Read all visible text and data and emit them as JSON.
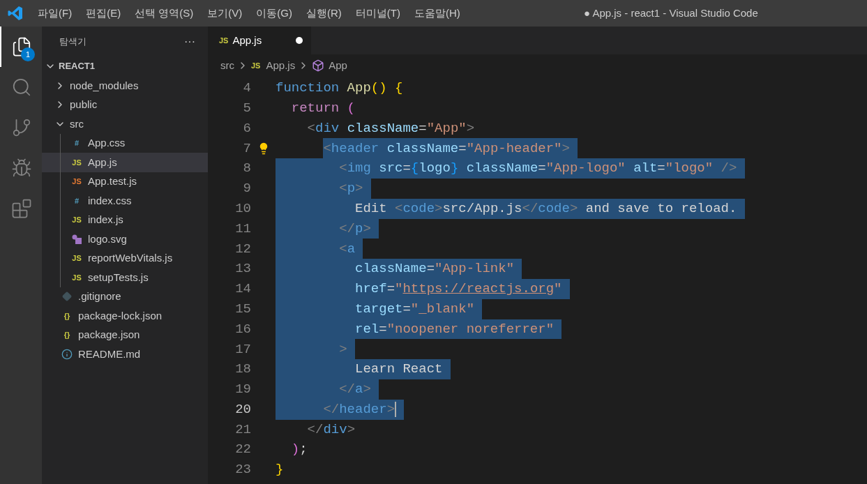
{
  "window": {
    "title": "● App.js - react1 - Visual Studio Code"
  },
  "menu": [
    "파일(F)",
    "편집(E)",
    "선택 영역(S)",
    "보기(V)",
    "이동(G)",
    "실행(R)",
    "터미널(T)",
    "도움말(H)"
  ],
  "activity_bar": [
    {
      "kind": "explorer",
      "selected": true,
      "badge": "1"
    },
    {
      "kind": "search",
      "selected": false
    },
    {
      "kind": "source-control",
      "selected": false
    },
    {
      "kind": "run",
      "selected": false
    },
    {
      "kind": "extensions",
      "selected": false
    }
  ],
  "sidebar": {
    "title": "탐색기",
    "more": "···",
    "root": {
      "label": "REACT1",
      "expanded": true,
      "children": [
        {
          "label": "node_modules",
          "kind": "folder",
          "expanded": false,
          "selected": false
        },
        {
          "label": "public",
          "kind": "folder",
          "expanded": false,
          "selected": false
        },
        {
          "label": "src",
          "kind": "folder",
          "expanded": true,
          "selected": false,
          "children": [
            {
              "label": "App.css",
              "kind": "css",
              "glyph": "#",
              "selected": false
            },
            {
              "label": "App.js",
              "kind": "js",
              "glyph": "JS",
              "selected": true
            },
            {
              "label": "App.test.js",
              "kind": "test",
              "glyph": "JS",
              "selected": false
            },
            {
              "label": "index.css",
              "kind": "css",
              "glyph": "#",
              "selected": false
            },
            {
              "label": "index.js",
              "kind": "js",
              "glyph": "JS",
              "selected": false
            },
            {
              "label": "logo.svg",
              "kind": "svg",
              "selected": false
            },
            {
              "label": "reportWebVitals.js",
              "kind": "js",
              "glyph": "JS",
              "selected": false
            },
            {
              "label": "setupTests.js",
              "kind": "js",
              "glyph": "JS",
              "selected": false
            }
          ]
        },
        {
          "label": ".gitignore",
          "kind": "git",
          "selected": false
        },
        {
          "label": "package-lock.json",
          "kind": "json",
          "glyph": "{}",
          "selected": false
        },
        {
          "label": "package.json",
          "kind": "json",
          "glyph": "{}",
          "selected": false
        },
        {
          "label": "README.md",
          "kind": "info",
          "selected": false
        }
      ]
    }
  },
  "tabs": [
    {
      "label": "App.js",
      "glyph": "JS",
      "selected": true,
      "modified": true
    }
  ],
  "breadcrumb": [
    {
      "label": "src",
      "kind": "folder"
    },
    {
      "label": "App.js",
      "kind": "js",
      "glyph": "JS"
    },
    {
      "label": "App",
      "kind": "component"
    }
  ],
  "editor": {
    "lines": [
      {
        "number": "4",
        "selected": false,
        "current": false,
        "tokens": [
          {
            "kind": "kw",
            "text": "function"
          },
          {
            "kind": "fn",
            "text": " App"
          },
          {
            "kind": "br1",
            "text": "() {"
          }
        ]
      },
      {
        "number": "5",
        "selected": false,
        "current": false,
        "tokens": [
          {
            "kind": "ctl",
            "text": "  return"
          },
          {
            "kind": "br2",
            "text": " ("
          }
        ]
      },
      {
        "number": "6",
        "selected": false,
        "current": false,
        "tokens": [
          {
            "kind": "punct",
            "text": "    <"
          },
          {
            "kind": "tag",
            "text": "div"
          },
          {
            "kind": "attr",
            "text": " className"
          },
          {
            "kind": "txt",
            "text": "="
          },
          {
            "kind": "str",
            "text": "\"App\""
          },
          {
            "kind": "punct",
            "text": ">"
          }
        ]
      },
      {
        "number": "7",
        "selected": true,
        "current": false,
        "lightbulb": true,
        "tokens": [
          {
            "kind": "punct",
            "text": "      <"
          },
          {
            "kind": "tag",
            "text": "header"
          },
          {
            "kind": "attr",
            "text": " className"
          },
          {
            "kind": "txt",
            "text": "="
          },
          {
            "kind": "str",
            "text": "\"App-header\""
          },
          {
            "kind": "punct",
            "text": ">"
          }
        ]
      },
      {
        "number": "8",
        "selected": true,
        "current": false,
        "tokens": [
          {
            "kind": "punct",
            "text": "        <"
          },
          {
            "kind": "tag",
            "text": "img"
          },
          {
            "kind": "attr",
            "text": " src"
          },
          {
            "kind": "txt",
            "text": "="
          },
          {
            "kind": "br3",
            "text": "{"
          },
          {
            "kind": "var",
            "text": "logo"
          },
          {
            "kind": "br3",
            "text": "}"
          },
          {
            "kind": "attr",
            "text": " className"
          },
          {
            "kind": "txt",
            "text": "="
          },
          {
            "kind": "str",
            "text": "\"App-logo\""
          },
          {
            "kind": "attr",
            "text": " alt"
          },
          {
            "kind": "txt",
            "text": "="
          },
          {
            "kind": "str",
            "text": "\"logo\""
          },
          {
            "kind": "punct",
            "text": " />"
          }
        ]
      },
      {
        "number": "9",
        "selected": true,
        "current": false,
        "tokens": [
          {
            "kind": "punct",
            "text": "        <"
          },
          {
            "kind": "tag",
            "text": "p"
          },
          {
            "kind": "punct",
            "text": ">"
          }
        ]
      },
      {
        "number": "10",
        "selected": true,
        "current": false,
        "tokens": [
          {
            "kind": "txt",
            "text": "          Edit"
          },
          {
            "kind": "punct",
            "text": " <"
          },
          {
            "kind": "tag",
            "text": "code"
          },
          {
            "kind": "punct",
            "text": ">"
          },
          {
            "kind": "txt",
            "text": "src/App.js"
          },
          {
            "kind": "punct",
            "text": "</"
          },
          {
            "kind": "tag",
            "text": "code"
          },
          {
            "kind": "punct",
            "text": ">"
          },
          {
            "kind": "txt",
            "text": " and save to reload."
          }
        ]
      },
      {
        "number": "11",
        "selected": true,
        "current": false,
        "tokens": [
          {
            "kind": "punct",
            "text": "        </"
          },
          {
            "kind": "tag",
            "text": "p"
          },
          {
            "kind": "punct",
            "text": ">"
          }
        ]
      },
      {
        "number": "12",
        "selected": true,
        "current": false,
        "tokens": [
          {
            "kind": "punct",
            "text": "        <"
          },
          {
            "kind": "tag",
            "text": "a"
          }
        ]
      },
      {
        "number": "13",
        "selected": true,
        "current": false,
        "tokens": [
          {
            "kind": "attr",
            "text": "          className"
          },
          {
            "kind": "txt",
            "text": "="
          },
          {
            "kind": "str",
            "text": "\"App-link\""
          }
        ]
      },
      {
        "number": "14",
        "selected": true,
        "current": false,
        "tokens": [
          {
            "kind": "attr",
            "text": "          href"
          },
          {
            "kind": "txt",
            "text": "="
          },
          {
            "kind": "str",
            "text": "\""
          },
          {
            "kind": "url",
            "text": "https://reactjs.org"
          },
          {
            "kind": "str",
            "text": "\""
          }
        ]
      },
      {
        "number": "15",
        "selected": true,
        "current": false,
        "tokens": [
          {
            "kind": "attr",
            "text": "          target"
          },
          {
            "kind": "txt",
            "text": "="
          },
          {
            "kind": "str",
            "text": "\"_blank\""
          }
        ]
      },
      {
        "number": "16",
        "selected": true,
        "current": false,
        "tokens": [
          {
            "kind": "attr",
            "text": "          rel"
          },
          {
            "kind": "txt",
            "text": "="
          },
          {
            "kind": "str",
            "text": "\"noopener noreferrer\""
          }
        ]
      },
      {
        "number": "17",
        "selected": true,
        "current": false,
        "tokens": [
          {
            "kind": "punct",
            "text": "        >"
          }
        ]
      },
      {
        "number": "18",
        "selected": true,
        "current": false,
        "tokens": [
          {
            "kind": "txt",
            "text": "          Learn React"
          }
        ]
      },
      {
        "number": "19",
        "selected": true,
        "current": false,
        "tokens": [
          {
            "kind": "punct",
            "text": "        </"
          },
          {
            "kind": "tag",
            "text": "a"
          },
          {
            "kind": "punct",
            "text": ">"
          }
        ]
      },
      {
        "number": "20",
        "selected": true,
        "current": true,
        "tokens": [
          {
            "kind": "punct",
            "text": "      </"
          },
          {
            "kind": "tag",
            "text": "header"
          },
          {
            "kind": "punct",
            "text": ">"
          }
        ]
      },
      {
        "number": "21",
        "selected": false,
        "current": false,
        "tokens": [
          {
            "kind": "punct",
            "text": "    </"
          },
          {
            "kind": "tag",
            "text": "div"
          },
          {
            "kind": "punct",
            "text": ">"
          }
        ]
      },
      {
        "number": "22",
        "selected": false,
        "current": false,
        "tokens": [
          {
            "kind": "br2",
            "text": "  )"
          },
          {
            "kind": "txt",
            "text": ";"
          }
        ]
      },
      {
        "number": "23",
        "selected": false,
        "current": false,
        "tokens": [
          {
            "kind": "br1",
            "text": "}"
          }
        ]
      }
    ]
  }
}
